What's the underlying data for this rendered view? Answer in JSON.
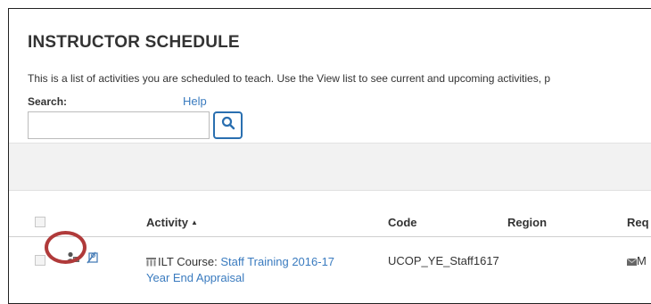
{
  "page": {
    "title": "INSTRUCTOR SCHEDULE",
    "description": "This is a list of activities you are scheduled to teach. Use the View list to see current and upcoming activities, p"
  },
  "search": {
    "label": "Search:",
    "help": "Help",
    "value": "",
    "placeholder": ""
  },
  "table": {
    "headers": {
      "activity": "Activity",
      "code": "Code",
      "region": "Region",
      "requester": "Req"
    },
    "rows": [
      {
        "activity_type": "ILT Course:",
        "activity_name_line1": "Staff Training 2016-17",
        "activity_name_line2": "Year End Appraisal",
        "code": "UCOP_YE_Staff1617",
        "region": "",
        "requester": "M"
      }
    ]
  },
  "icons": {
    "search": "search-icon",
    "roster": "roster-icon",
    "edit": "edit-icon",
    "course": "course-icon",
    "email": "email-icon",
    "sort": "sort-ascending-icon"
  },
  "colors": {
    "link": "#3a7bbf",
    "search_button_border": "#2a6fb0",
    "highlight_circle": "#b03a3a"
  }
}
